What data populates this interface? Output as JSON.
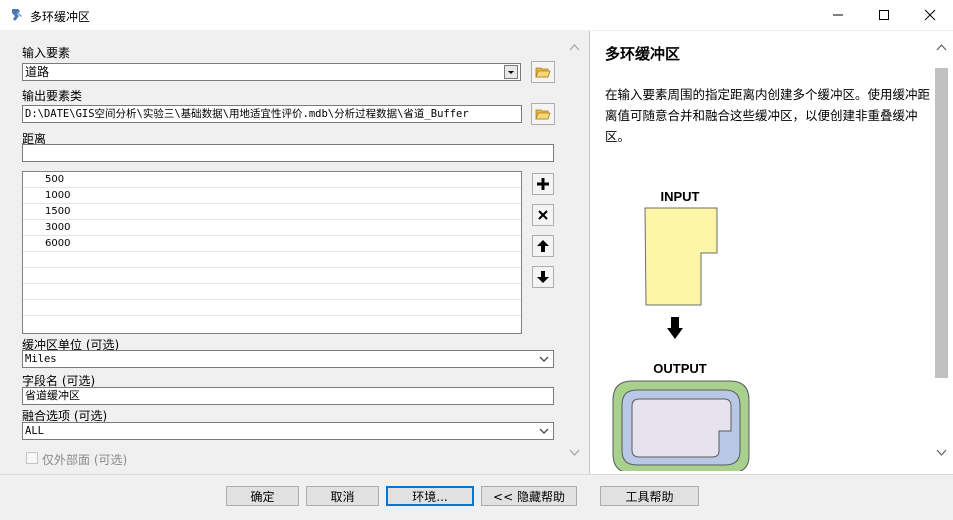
{
  "window": {
    "title": "多环缓冲区"
  },
  "form": {
    "input_label": "输入要素",
    "input_value": "道路",
    "output_label": "输出要素类",
    "output_value": "D:\\DATE\\GIS空间分析\\实验三\\基础数据\\用地适宜性评价.mdb\\分析过程数据\\省道_Buffer",
    "distance_label": "距离",
    "distance_value": "",
    "distances": [
      "500",
      "1000",
      "1500",
      "3000",
      "6000"
    ],
    "unit_label": "缓冲区单位 (可选)",
    "unit_value": "Miles",
    "field_label": "字段名 (可选)",
    "field_value": "省道缓冲区",
    "dissolve_label": "融合选项 (可选)",
    "dissolve_value": "ALL",
    "outside_label": "仅外部面 (可选)"
  },
  "help": {
    "title": "多环缓冲区",
    "text": "在输入要素周围的指定距离内创建多个缓冲区。使用缓冲距离值可随意合并和融合这些缓冲区，以便创建非重叠缓冲区。",
    "input_caption": "INPUT",
    "output_caption": "OUTPUT"
  },
  "buttons": {
    "ok": "确定",
    "cancel": "取消",
    "env": "环境...",
    "hide_help": "<< 隐藏帮助",
    "tool_help": "工具帮助"
  },
  "colors": {
    "input_poly": "#fdf6a6",
    "ring_inner": "#b8c8e6",
    "ring_outer": "#a9d18e",
    "focus": "#0078d7"
  }
}
